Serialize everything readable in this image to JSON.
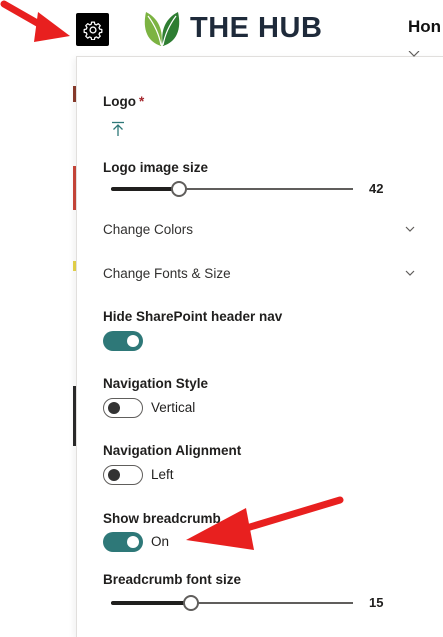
{
  "header": {
    "logo_text": "THE HUB",
    "nav_peek": "Hon"
  },
  "panel": {
    "logo": {
      "label": "Logo",
      "required_marker": "*"
    },
    "logo_size": {
      "label": "Logo image size",
      "value": "42",
      "fraction": 0.28
    },
    "change_colors": {
      "label": "Change Colors"
    },
    "change_fonts": {
      "label": "Change Fonts & Size"
    },
    "hide_header_nav": {
      "label": "Hide SharePoint header nav",
      "state": "on"
    },
    "nav_style": {
      "label": "Navigation Style",
      "state": "off",
      "state_text": "Vertical"
    },
    "nav_alignment": {
      "label": "Navigation Alignment",
      "state": "off",
      "state_text": "Left"
    },
    "breadcrumb": {
      "label": "Show breadcrumb",
      "state": "on",
      "state_text": "On"
    },
    "breadcrumb_font": {
      "label": "Breadcrumb font size",
      "value": "15",
      "fraction": 0.33
    }
  },
  "colors": {
    "toggle_on": "#2e7878",
    "arrow": "#e8201f",
    "logo_text": "#1e2a3a",
    "leaf_dark": "#2e7d32",
    "leaf_light": "#7cb342"
  },
  "icons": [
    "gear-icon",
    "upload-icon",
    "chevron-down-icon",
    "close-icon",
    "red-arrow"
  ]
}
